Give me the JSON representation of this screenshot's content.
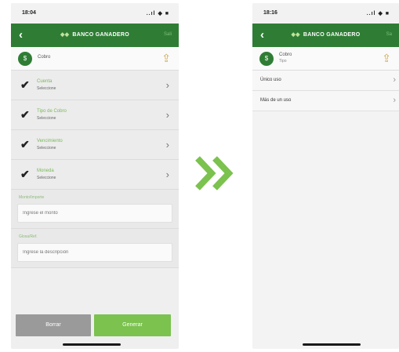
{
  "left": {
    "status": {
      "time": "18:04",
      "system": "..ıl ◆ ■"
    },
    "nav": {
      "back": "‹",
      "logo": "BANCO GANADERO",
      "action": "Sali"
    },
    "header": {
      "title": "Cobro",
      "avatar": "$"
    },
    "rows": [
      {
        "label": "Cuenta",
        "sub": "Seleccione"
      },
      {
        "label": "Tipo de Cobro",
        "sub": "Seleccione"
      },
      {
        "label": "Vencimiento",
        "sub": "Seleccione"
      },
      {
        "label": "Moneda",
        "sub": "Seleccione"
      }
    ],
    "fields": [
      {
        "label": "Monto/Importe",
        "placeholder": "Ingrese el monto"
      },
      {
        "label": "Glosa/Ref.",
        "placeholder": "Ingrese la descripción"
      }
    ],
    "buttons": {
      "cancel": "Borrar",
      "generate": "Generar"
    }
  },
  "right": {
    "status": {
      "time": "18:16",
      "system": "..ıl ◆ ■"
    },
    "nav": {
      "back": "‹",
      "logo": "BANCO GANADERO",
      "action": "Sa"
    },
    "header": {
      "title": "Cobro",
      "subtitle": "Tipo",
      "avatar": "$"
    },
    "options": [
      {
        "label": "Único uso"
      },
      {
        "label": "Más de un uso"
      }
    ]
  },
  "colors": {
    "brand_green": "#2f7d35",
    "accent_green": "#7bc24e",
    "gray_button": "#9a9a9a"
  }
}
